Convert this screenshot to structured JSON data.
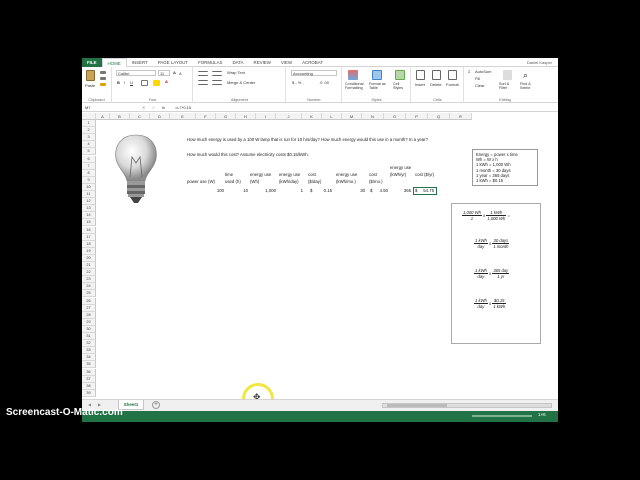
{
  "tabs": [
    "FILE",
    "HOME",
    "INSERT",
    "PAGE LAYOUT",
    "FORMULAS",
    "DATA",
    "REVIEW",
    "VIEW",
    "ACROBAT"
  ],
  "user_name": "Daniel Kasper",
  "ribbon": {
    "paste": "Paste",
    "clipboard": "Clipboard",
    "font_name": "Calibri",
    "font_size": "11",
    "font_group": "Font",
    "wrap_text": "Wrap Text",
    "merge_center": "Merge & Center",
    "alignment_group": "Alignment",
    "number_format": "Accounting",
    "number_group": "Number",
    "conditional_formatting": "Conditional Formatting",
    "format_as_table": "Format as Table",
    "cell_styles": "Cell Styles",
    "styles_group": "Styles",
    "insert": "Insert",
    "delete": "Delete",
    "format": "Format",
    "cells_group": "Cells",
    "autosum": "AutoSum",
    "fill": "Fill",
    "clear": "Clear",
    "sort_filter": "Sort & Filter",
    "find_select": "Find & Select",
    "editing_group": "Editing"
  },
  "formula_bar": {
    "name_box": "M7",
    "fx": "fx",
    "formula": "=L7*0.15"
  },
  "columns": [
    "A",
    "B",
    "C",
    "D",
    "E",
    "F",
    "G",
    "H",
    "I",
    "J",
    "K",
    "L",
    "M",
    "N",
    "O",
    "P",
    "Q",
    "R"
  ],
  "rows": [
    "1",
    "2",
    "3",
    "4",
    "5",
    "6",
    "7",
    "8",
    "9",
    "10",
    "11",
    "12",
    "13",
    "14",
    "15",
    "16",
    "17",
    "18",
    "19",
    "20",
    "21",
    "22",
    "23",
    "24",
    "25",
    "26",
    "27",
    "28",
    "29",
    "30",
    "31",
    "32",
    "33",
    "34",
    "35",
    "36",
    "37",
    "38",
    "39"
  ],
  "sheet": {
    "question1": "How much energy is used by a 100 W lamp that is run for 10 hrs/day?  How much energy would this use in a month? In a year?",
    "question2": "How much would this cost?  Assume electricity costs $0.15/kWh.",
    "headers": {
      "power": "power use (W)",
      "time": "time used (h)",
      "energy_wh": "energy use (Wh)",
      "energy_kwh_day": "energy use (kWh/day)",
      "cost_day": "cost ($/day)",
      "energy_kwh_mo": "energy use (kWh/mo.)",
      "cost_mo": "cost ($/mo.)",
      "energy_kwh_yr": "energy use (kWh/yr)",
      "cost_yr": "cost ($/yr)"
    },
    "values": {
      "power": "100",
      "time": "10",
      "energy_wh": "1,000",
      "energy_kwh_day": "1",
      "cost_day_sym": "$",
      "cost_day": "0.15",
      "energy_kwh_mo": "30",
      "cost_mo_sym": "$",
      "cost_mo": "4.50",
      "energy_kwh_yr": "365",
      "cost_yr_sym": "$",
      "cost_yr": "54.75"
    }
  },
  "notes": {
    "lines": [
      "Energy = power x time",
      "Wh = W x h",
      "1 kWh = 1,000 Wh",
      "1 month = 30 days",
      "1 year = 365 days",
      "1 kWh = $0.15"
    ]
  },
  "conversion": {
    "f1_top": "1,000 Wh",
    "f1_bot": "1",
    "f2_top": "1 kWh",
    "f2_bot": "1,000 Wh",
    "f3_top": "1 kWh",
    "f3_bot": "day",
    "f4_top": "30 days",
    "f4_bot": "1 month",
    "f5_top": "1 kWh",
    "f5_bot": "day",
    "f6_top": "365 day",
    "f6_bot": "1 yr",
    "f7_top": "1 kWh",
    "f7_bot": "day",
    "f8_top": "$0.15",
    "f8_bot": "1 kWh",
    "times": "x",
    "equals": "="
  },
  "sheet_tab": "Sheet1",
  "zoom": "1×6",
  "watermark": "Screencast-O-Matic.com",
  "colors": {
    "excel_green": "#217346",
    "highlight_ring": "#f2e640"
  }
}
